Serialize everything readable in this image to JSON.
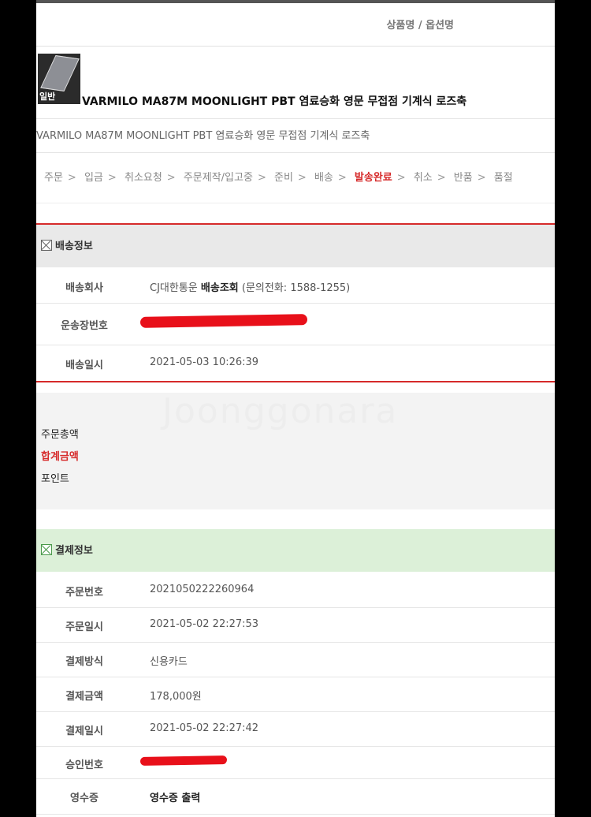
{
  "header": {
    "product_option_label": "상품명 / 옵션명"
  },
  "product": {
    "badge": "일반",
    "name": "VARMILO MA87M MOONLIGHT PBT 염료승화 영문 무접점 기계식 로즈축",
    "option": "VARMILO MA87M MOONLIGHT PBT 염료승화 영문 무접점 기계식 로즈축"
  },
  "steps": [
    "주문",
    "입금",
    "취소요청",
    "주문제작/입고중",
    "준비",
    "배송",
    "발송완료",
    "취소",
    "반품",
    "품절"
  ],
  "active_step": "발송완료",
  "shipping": {
    "title": "배송정보",
    "carrier_label": "배송회사",
    "carrier": "CJ대한통운",
    "tracking_link": "배송조회",
    "phone": "(문의전화: 1588-1255)",
    "invoice_label": "운송장번호",
    "date_label": "배송일시",
    "date": "2021-05-03 10:26:39"
  },
  "summary": {
    "total_order": "주문총액",
    "sum": "합계금액",
    "points": "포인트"
  },
  "watermark": "Joonggonara",
  "payment": {
    "title": "결제정보",
    "rows": [
      {
        "label": "주문번호",
        "value": "2021050222260964"
      },
      {
        "label": "주문일시",
        "value": "2021-05-02 22:27:53"
      },
      {
        "label": "결제방식",
        "value": "신용카드"
      },
      {
        "label": "결제금액",
        "value": "178,000원"
      },
      {
        "label": "결제일시",
        "value": "2021-05-02 22:27:42"
      },
      {
        "label": "승인번호",
        "value": ""
      },
      {
        "label": "영수증",
        "value": "영수증 출력"
      }
    ]
  },
  "colors": {
    "accent_red": "#d62a2a",
    "payment_header_bg": "#dcf0d8",
    "redaction": "#e8101a"
  }
}
